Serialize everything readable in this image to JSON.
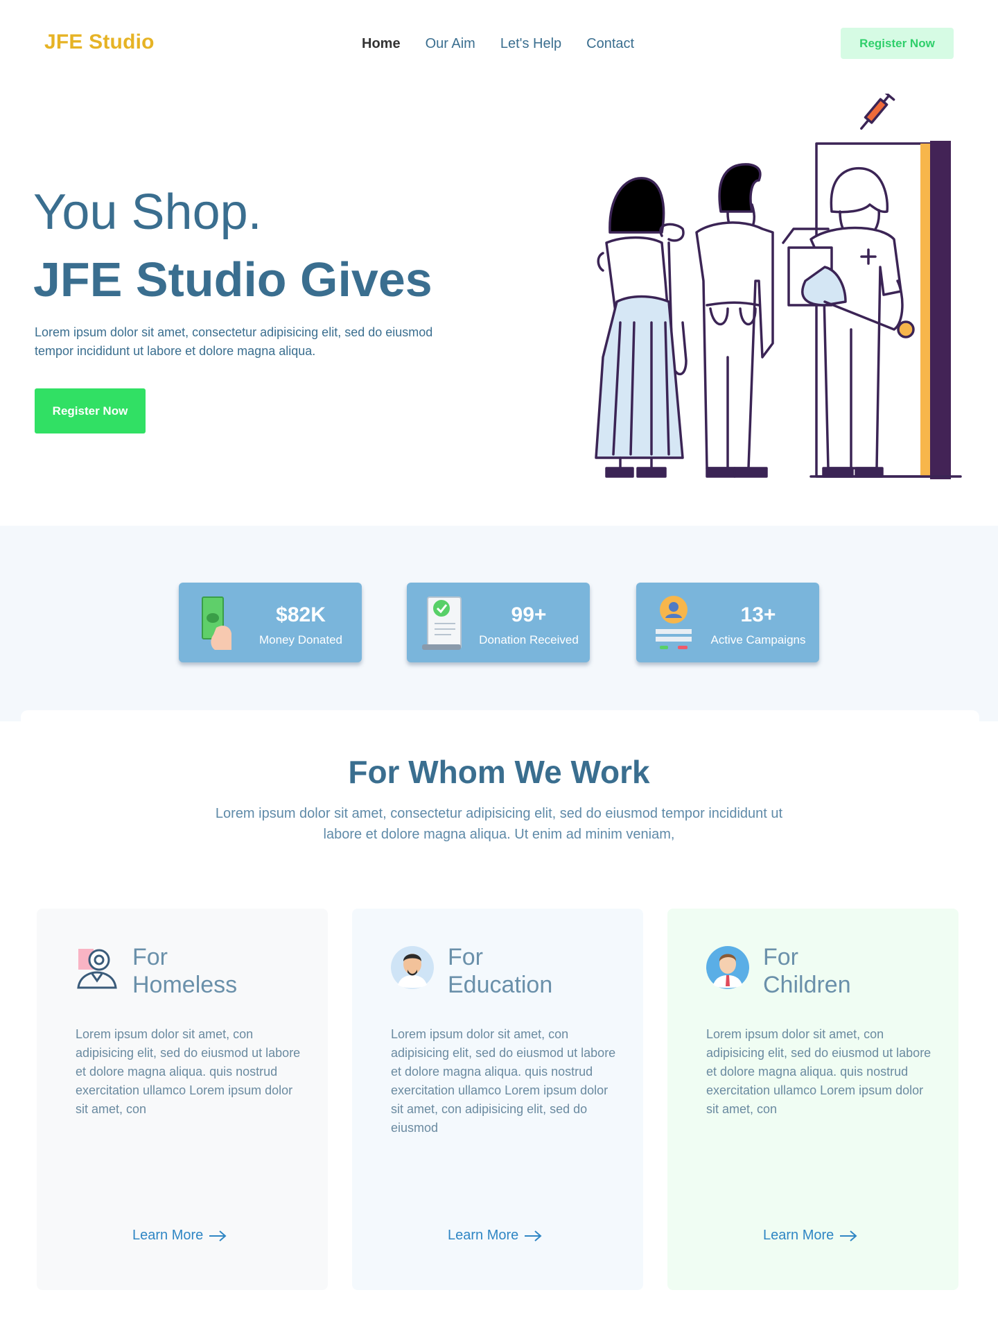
{
  "header": {
    "logo": "JFE Studio",
    "nav": [
      {
        "label": "Home",
        "active": true
      },
      {
        "label": "Our Aim"
      },
      {
        "label": "Let's Help"
      },
      {
        "label": "Contact"
      }
    ],
    "cta": "Register Now"
  },
  "hero": {
    "title_line1": "You Shop.",
    "title_line2": "JFE Studio Gives",
    "text": "Lorem ipsum dolor sit amet, consectetur adipisicing elit, sed do eiusmod tempor incididunt ut labore et dolore magna aliqua.",
    "button": "Register Now"
  },
  "stats": [
    {
      "value": "$82K",
      "label": "Money Donated",
      "icon": "money-hand-icon"
    },
    {
      "value": "99+",
      "label": "Donation Received",
      "icon": "receipt-check-icon"
    },
    {
      "value": "13+",
      "label": "Active Campaigns",
      "icon": "user-profile-icon"
    }
  ],
  "section": {
    "title": "For Whom We Work",
    "text": "Lorem ipsum dolor sit amet, consectetur adipisicing elit, sed do eiusmod tempor incididunt ut labore et dolore magna aliqua. Ut enim ad minim veniam,"
  },
  "cards": [
    {
      "title": "For Homeless",
      "text": "Lorem ipsum dolor sit amet, con adipisicing elit, sed do eiusmod ut labore et dolore magna aliqua. quis nostrud exercitation ullamco Lorem ipsum dolor sit amet, con",
      "link": "Learn More",
      "icon": "worker-gear-icon",
      "bg": "#f8f9fa"
    },
    {
      "title": "For Education",
      "text": "Lorem ipsum dolor sit amet, con adipisicing elit, sed do eiusmod ut labore et dolore magna aliqua. quis nostrud exercitation ullamco Lorem ipsum dolor sit amet, con adipisicing elit, sed do eiusmod",
      "link": "Learn More",
      "icon": "teacher-avatar-icon",
      "bg": "#f4f9fd"
    },
    {
      "title": "For Children",
      "text": "Lorem ipsum dolor sit amet, con adipisicing elit, sed do eiusmod ut labore et dolore magna aliqua. quis nostrud exercitation ullamco Lorem ipsum dolor sit amet, con",
      "link": "Learn More",
      "icon": "child-avatar-icon",
      "bg": "#f0fdf3"
    }
  ],
  "colors": {
    "brand": "#e6b325",
    "primary": "#3a6e8f",
    "accent_green": "#31e064",
    "stat_card": "#7ab5db",
    "link": "#2f86c4"
  }
}
